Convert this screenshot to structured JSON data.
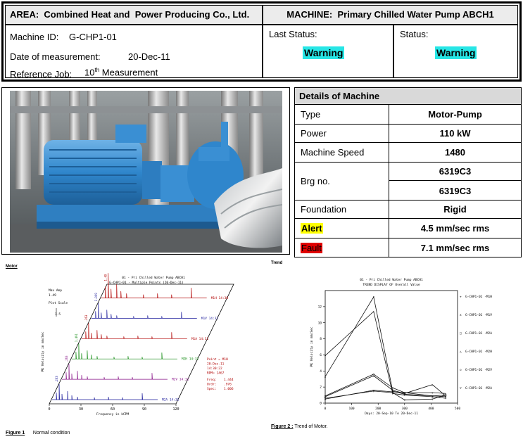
{
  "header": {
    "area_label": "AREA:",
    "area_value": "Combined Heat and  Power Producing Co., Ltd.",
    "machine_label": "MACHINE:",
    "machine_value": "Primary Chilled Water Pump ABCH1",
    "machine_id_label": "Machine ID:",
    "machine_id_value": "G-CHP1-01",
    "date_label": "Date of measurement:",
    "date_value": "20-Dec-11",
    "ref_label": "Reference Job:",
    "ref_num": "10",
    "ref_sup": "th",
    "ref_suffix": "Measurement",
    "last_status_label": "Last Status:",
    "last_status_value": "Warning",
    "status_label": "Status:",
    "status_value": "Warning",
    "status_color": "#27e6e6"
  },
  "details": {
    "title": "Details of Machine",
    "rows": [
      {
        "label": "Type",
        "value": "Motor-Pump"
      },
      {
        "label": "Power",
        "value": "110 kW"
      },
      {
        "label": "Machine Speed",
        "value": "1480"
      },
      {
        "label": "Brg no.",
        "value": "6319C3",
        "value2": "6319C3"
      },
      {
        "label": "Foundation",
        "value": "Rigid"
      },
      {
        "label": "Alert",
        "value": "4.5 mm/sec rms",
        "color": "#ffff00"
      },
      {
        "label": "Fault",
        "value": "7.1 mm/sec rms",
        "color": "#e00000"
      }
    ]
  },
  "motor": {
    "section_label": "Motor",
    "figure_num": "Figure 1",
    "figure_caption": "Normal condition"
  },
  "trend": {
    "section_label": "Trend",
    "figure_num": "Figure 2 :",
    "figure_caption": "Trend of Motor."
  },
  "chart_data": [
    {
      "type": "waterfall",
      "title": "01 - Pri Chilled Water Pump ABCH1",
      "subtitle": "G-CHP1-01 - Multiple Points (20-Dec-11)",
      "ylabel": "PK Velocity in mm/Sec",
      "xlabel": "Frequency in kCPM",
      "x_ticks": [
        "0",
        "30",
        "60",
        "90",
        "120"
      ],
      "max_amp_label": "Max Amp",
      "max_amp_value": "1.49",
      "plot_scale_label": "Plot Scale",
      "plot_scale_value": "1.5",
      "traces": [
        {
          "name": "M1H 14:30",
          "peak": "1.49",
          "color": "#b00000"
        },
        {
          "name": "M1V 14:31",
          "peak": "1.099",
          "color": "#1a1a9a"
        },
        {
          "name": "M1A 14:31",
          "peak": ".263",
          "color": "#b00000"
        },
        {
          "name": "M2H 14:31",
          "peak": "1.491",
          "color": "#118a11"
        },
        {
          "name": "M2V 14:31",
          "peak": ".263",
          "color": "#8a168a"
        },
        {
          "name": "M2A 14:31",
          "peak": ".263",
          "color": "#1a1a9a"
        }
      ],
      "info": [
        "Point = M1H",
        "20-Dec-11",
        "14:30:22",
        "RPM= 1467",
        "Freq:",
        "Ordr:",
        "Spec:"
      ],
      "info_values": [
        "1.444",
        ".976",
        "1.006"
      ]
    },
    {
      "type": "line",
      "title": "01 - Pri Chilled Water Pump ABCH1",
      "subtitle": "TREND DISPLAY OF Overall Value",
      "ylabel": "PK Velocity in mm/Sec",
      "xlabel": "Days: 20-Sep-10 To 20-Dec-11",
      "x_ticks": [
        0,
        100,
        200,
        300,
        400,
        500
      ],
      "y_ticks": [
        0,
        2,
        4,
        6,
        8,
        10,
        12
      ],
      "xlim": [
        0,
        500
      ],
      "ylim": [
        0,
        14
      ],
      "series": [
        {
          "name": "G-CHP1-01 -M1H",
          "x": [
            0,
            183,
            255,
            300,
            405,
            455
          ],
          "y": [
            5.9,
            11.4,
            1.2,
            1.0,
            0.8,
            0.6
          ]
        },
        {
          "name": "G-CHP1-01 -M1V",
          "x": [
            0,
            183,
            255,
            300,
            405,
            455
          ],
          "y": [
            3.3,
            13.2,
            1.5,
            1.1,
            0.9,
            0.8
          ]
        },
        {
          "name": "G-CHP1-01 -M2A",
          "x": [
            0,
            183,
            255,
            300,
            405,
            455
          ],
          "y": [
            0.9,
            3.6,
            1.9,
            1.3,
            0.9,
            1.0
          ]
        },
        {
          "name": "G-CHP1-01 -M2H",
          "x": [
            0,
            183,
            255,
            300,
            405,
            455
          ],
          "y": [
            0.8,
            3.4,
            1.6,
            1.2,
            2.3,
            0.9
          ]
        },
        {
          "name": "G-CHP1-01 -M2V",
          "x": [
            0,
            183,
            255,
            300,
            405,
            455
          ],
          "y": [
            0.5,
            1.6,
            1.4,
            1.3,
            1.3,
            1.2
          ]
        },
        {
          "name": "G-CHP1-01 -M2A",
          "x": [
            0,
            183,
            255,
            300,
            405,
            455
          ],
          "y": [
            0.6,
            1.5,
            1.3,
            0.4,
            0.5,
            1.0
          ]
        }
      ],
      "legend_markers": [
        "+",
        "x",
        "□",
        "△",
        "◇",
        "▽"
      ]
    }
  ]
}
